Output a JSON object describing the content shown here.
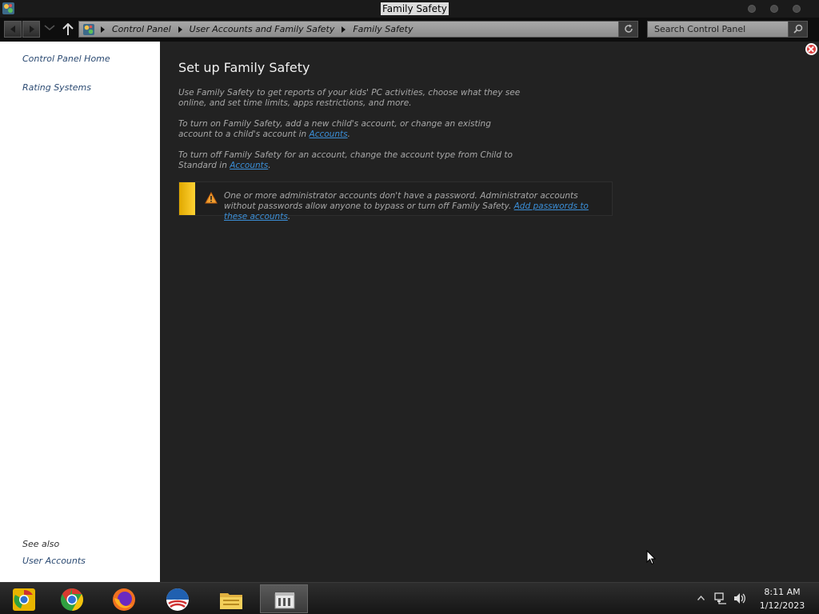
{
  "window": {
    "title": "Family Safety"
  },
  "nav": {
    "breadcrumb": [
      "Control Panel",
      "User Accounts and Family Safety",
      "Family Safety"
    ],
    "search_placeholder": "Search Control Panel"
  },
  "left_pane": {
    "links": [
      "Control Panel Home",
      "Rating Systems"
    ],
    "see_also_label": "See also",
    "see_also_links": [
      "User Accounts"
    ]
  },
  "main": {
    "title": "Set up Family Safety",
    "para1": "Use Family Safety to get reports of your kids' PC activities, choose what they see online, and set time limits, apps restrictions, and more.",
    "para2_text": "To turn on Family Safety, add a new child's account, or change an existing account to a child's account in ",
    "para2_link": "Accounts",
    "para3_text": "To turn off Family Safety for an account, change the account type from Child to Standard in ",
    "para3_link": "Accounts",
    "period": ".",
    "warning_text": "One or more administrator accounts don't have a password. Administrator accounts without passwords allow anyone to bypass or turn off Family Safety. ",
    "warning_link": "Add passwords to these accounts",
    "colors": {
      "main_bg": "#222222",
      "link": "#3b8fd8",
      "warning_stripe": "#ffc000"
    }
  },
  "taskbar": {
    "apps": [
      "chrome-canary-icon",
      "chrome-icon",
      "firefox-icon",
      "obama-campaign-icon",
      "file-explorer-icon",
      "control-panel-icon"
    ],
    "clock_time": "8:11 AM",
    "clock_date": "1/12/2023"
  }
}
